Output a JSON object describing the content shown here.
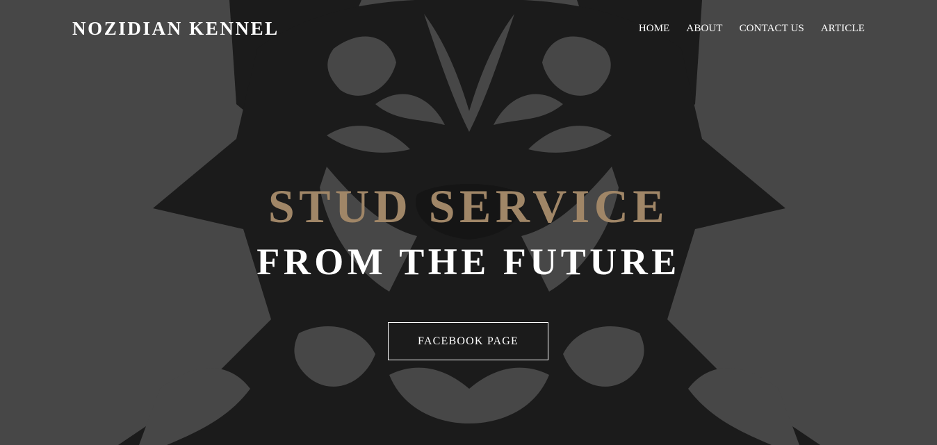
{
  "nav": {
    "brand": "NOZIDIAN KENNEL",
    "items": [
      {
        "label": "HOME"
      },
      {
        "label": "ABOUT"
      },
      {
        "label": "CONTACT US"
      },
      {
        "label": "ARTICLE"
      }
    ]
  },
  "hero": {
    "headline_1": "STUD SERVICE",
    "headline_2": "FROM THE FUTURE",
    "cta_label": "FACEBOOK PAGE",
    "background_image": "pitbull-tribal-head-illustration"
  },
  "colors": {
    "background": "#484848",
    "artwork": "#1a1a1a",
    "accent_gold": "#a08667",
    "text": "#ffffff"
  }
}
